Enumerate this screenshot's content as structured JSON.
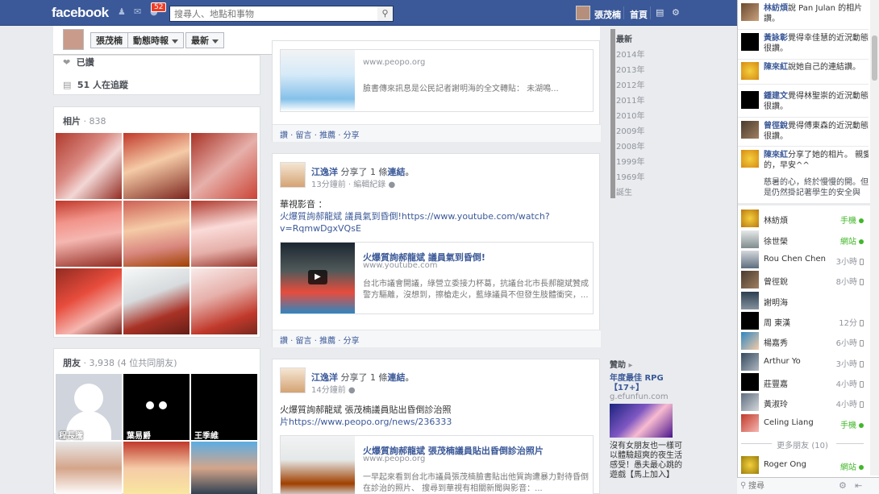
{
  "topbar": {
    "logo": "facebook",
    "notifications_count": "52",
    "search_placeholder": "搜尋人、地點和事物",
    "user_name": "張茂楠",
    "home_label": "首頁"
  },
  "subheader": {
    "name_button": "張茂楠",
    "activity_button": "動態時報",
    "recent_button": "最新"
  },
  "about_box": {
    "liked_label": "已讚",
    "followers_label": "51 人在追蹤"
  },
  "photos_box": {
    "title": "相片",
    "count": "838"
  },
  "friends_box": {
    "title": "朋友",
    "count": "3,938 (4 位共同朋友)",
    "friends": [
      {
        "name": "程長騰"
      },
      {
        "name": "葉易爵"
      },
      {
        "name": "王季維"
      }
    ]
  },
  "posts": [
    {
      "link_domain": "www.peopo.org",
      "link_desc": "臉書傳來訊息是公民記者謝明海的全文轉貼： 未湖鳴...",
      "actions": [
        "讚",
        "留言",
        "推薦",
        "分享"
      ]
    },
    {
      "author": "江逸洋",
      "verb": "分享了 1 條",
      "verb_link": "連結",
      "time": "13分鐘前 · 編輯紀錄",
      "text_line1": "華視影音 ：",
      "text_line2": "火爆質詢郝龍斌 議員氣到昏倒!https://www.youtube.com/watch?",
      "text_line3": "v=RqmwDgxVQsE",
      "link_title": "火爆質詢郝龍斌 議員氣到昏倒!",
      "link_domain": "www.youtube.com",
      "link_desc": "台北市議會開議，綠營立委接力杯葛，抗議台北市長郝龍斌贊成警方驅離，沒想到，擦槍走火，藍綠議員不但發生肢體衝突，...",
      "actions": [
        "讚",
        "留言",
        "推薦",
        "分享"
      ]
    },
    {
      "author": "江逸洋",
      "verb": "分享了 1 條",
      "verb_link": "連結",
      "time": "14分鐘前",
      "text_line1": "火爆質詢郝龍斌 張茂楠議員貼出昏倒診治照",
      "text_line2": "片https://www.peopo.org/news/236333",
      "link_title": "火爆質詢郝龍斌 張茂楠議員貼出昏倒診治照片",
      "link_domain": "www.peopo.org",
      "link_desc": "一早起來看到台北市議員張茂楠臉書貼出他質詢遭暴力對待昏倒在診治的照片、 搜尋到華視有相關新聞與影音：..."
    }
  ],
  "timeline_nav": [
    "最新",
    "2014年",
    "2013年",
    "2012年",
    "2011年",
    "2010年",
    "2009年",
    "2008年",
    "1999年",
    "1969年",
    "誕生"
  ],
  "ad": {
    "header": "贊助",
    "title": "年度最佳 RPG【17+】",
    "domain": "g.efunfun.com",
    "desc": "沒有女朋友也一樣可以體驗超爽的夜生活感受！愚夫最心跳的遊戲【馬上加入】"
  },
  "ticker": [
    {
      "name": "林紡煩",
      "text": "說 Pan Julan 的相片讚。"
    },
    {
      "name": "黃詠彰",
      "text": "覺得幸佳慧的近況動態很讚。"
    },
    {
      "name": "陳來紅",
      "text": "說她自己的連結讚。"
    },
    {
      "name": "鍾建文",
      "text": "覺得林聖崇的近況動態很讚。"
    },
    {
      "name": "曾徑銳",
      "text": "覺得傅東森的近況動態很讚。"
    },
    {
      "name": "陳來紅",
      "text": "分享了她的相片。 親愛的，早安^^"
    },
    {
      "name": "",
      "text": "慈暑的心，終於慢慢的開。但是仍然掛記著學生的安全與"
    }
  ],
  "chat_friends": [
    {
      "name": "林紡煩",
      "status": "手機",
      "online": true
    },
    {
      "name": "徐世榮",
      "status": "網站",
      "online": true
    },
    {
      "name": "Rou Chen Chen",
      "status": "3小時",
      "online": false
    },
    {
      "name": "曾徑銳",
      "status": "8小時",
      "online": false
    },
    {
      "name": "謝明海",
      "status": "",
      "online": false
    },
    {
      "name": "周 東漢",
      "status": "12分",
      "online": false
    },
    {
      "name": "楊嘉秀",
      "status": "6小時",
      "online": false
    },
    {
      "name": "Arthur Yo",
      "status": "3小時",
      "online": false
    },
    {
      "name": "莊豐嘉",
      "status": "4小時",
      "online": false
    },
    {
      "name": "黃淑玲",
      "status": "4小時",
      "online": false
    },
    {
      "name": "Celing Liang",
      "status": "手機",
      "online": true
    }
  ],
  "more_friends": "更多朋友 (10)",
  "chat_friends_more": [
    {
      "name": "Roger Ong",
      "status": "網站",
      "online": true
    }
  ],
  "chat_search_placeholder": "搜尋"
}
